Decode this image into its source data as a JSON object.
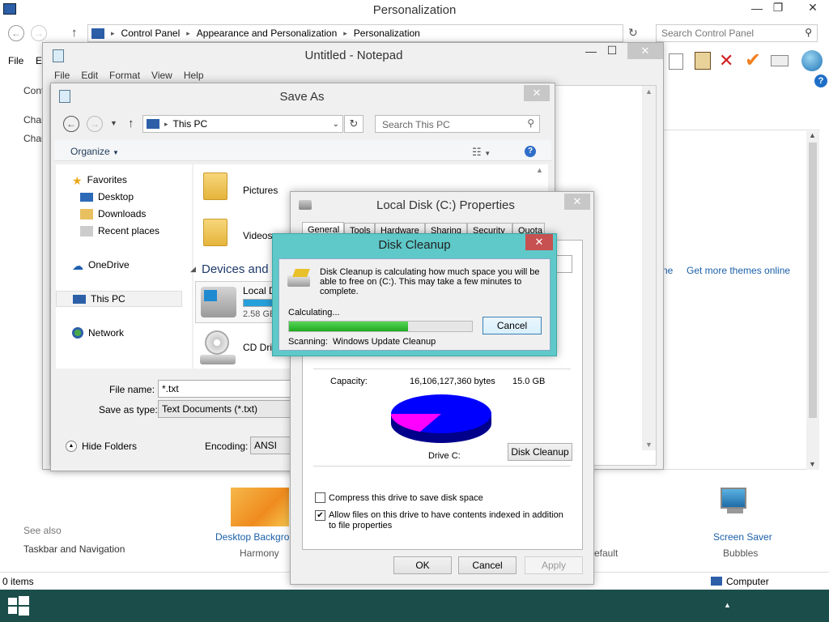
{
  "personalization": {
    "title": "Personalization",
    "breadcrumb": [
      "Control Panel",
      "Appearance and Personalization",
      "Personalization"
    ],
    "search_placeholder": "Search Control Panel",
    "menu_file": "File",
    "menu_edit_partial": "Ec",
    "left_text1": "Cont",
    "left_text2": "Chan",
    "left_text3": "Chan",
    "get_themes_partial": "ne",
    "get_themes": "Get more themes online",
    "see_also": "See also",
    "taskbar_nav": "Taskbar and Navigation",
    "desktop_bg": "Desktop Backgrou",
    "desktop_bg_sub": "Harmony",
    "color_sub_partial": "efault",
    "screen_saver": "Screen Saver",
    "screen_saver_sub": "Bubbles",
    "status_items": "0 items",
    "status_computer": "Computer"
  },
  "notepad": {
    "title": "Untitled - Notepad",
    "menu": [
      "File",
      "Edit",
      "Format",
      "View",
      "Help"
    ]
  },
  "saveas": {
    "title": "Save As",
    "location": "This PC",
    "search_placeholder": "Search This PC",
    "organize": "Organize",
    "nav": {
      "favorites": "Favorites",
      "desktop": "Desktop",
      "downloads": "Downloads",
      "recent": "Recent places",
      "onedrive": "OneDrive",
      "thispc": "This PC",
      "network": "Network"
    },
    "folders": [
      "Pictures",
      "Videos"
    ],
    "devices_header": "Devices and d",
    "local_disk": "Local D",
    "local_disk_size": "2.58 GB",
    "local_disk_fill": 0.8,
    "cd_drive": "CD Driv",
    "file_name_label": "File name:",
    "file_name_value": "*.txt",
    "save_type_label": "Save as type:",
    "save_type_value": "Text Documents (*.txt)",
    "hide_folders": "Hide Folders",
    "encoding_label": "Encoding:",
    "encoding_value": "ANSI"
  },
  "properties": {
    "title": "Local Disk (C:) Properties",
    "tabs": [
      "General",
      "Tools",
      "Hardware",
      "Sharing",
      "Security",
      "Quota"
    ],
    "capacity_label": "Capacity:",
    "capacity_bytes": "16,106,127,360 bytes",
    "capacity_gb": "15.0 GB",
    "drive_label": "Drive C:",
    "disk_cleanup_btn": "Disk Cleanup",
    "compress_label": "Compress this drive to save disk space",
    "compress_checked": false,
    "index_label": "Allow files on this drive to have contents indexed in addition to file properties",
    "index_checked": true,
    "ok": "OK",
    "cancel": "Cancel",
    "apply": "Apply",
    "colors": {
      "used": "#0000ff",
      "free": "#ff00ff"
    }
  },
  "cleanup": {
    "title": "Disk Cleanup",
    "message": "Disk Cleanup is calculating how much space you will be able to free on  (C:). This may take a few minutes to complete.",
    "calculating": "Calculating...",
    "progress": 0.65,
    "cancel": "Cancel",
    "scanning_label": "Scanning:",
    "scanning_value": "Windows Update Cleanup"
  },
  "colors": {
    "taskbar": "#1b4e4a",
    "accent": "#5fc8c8",
    "close_red": "#c75050",
    "progress": "#2bbd2b"
  }
}
